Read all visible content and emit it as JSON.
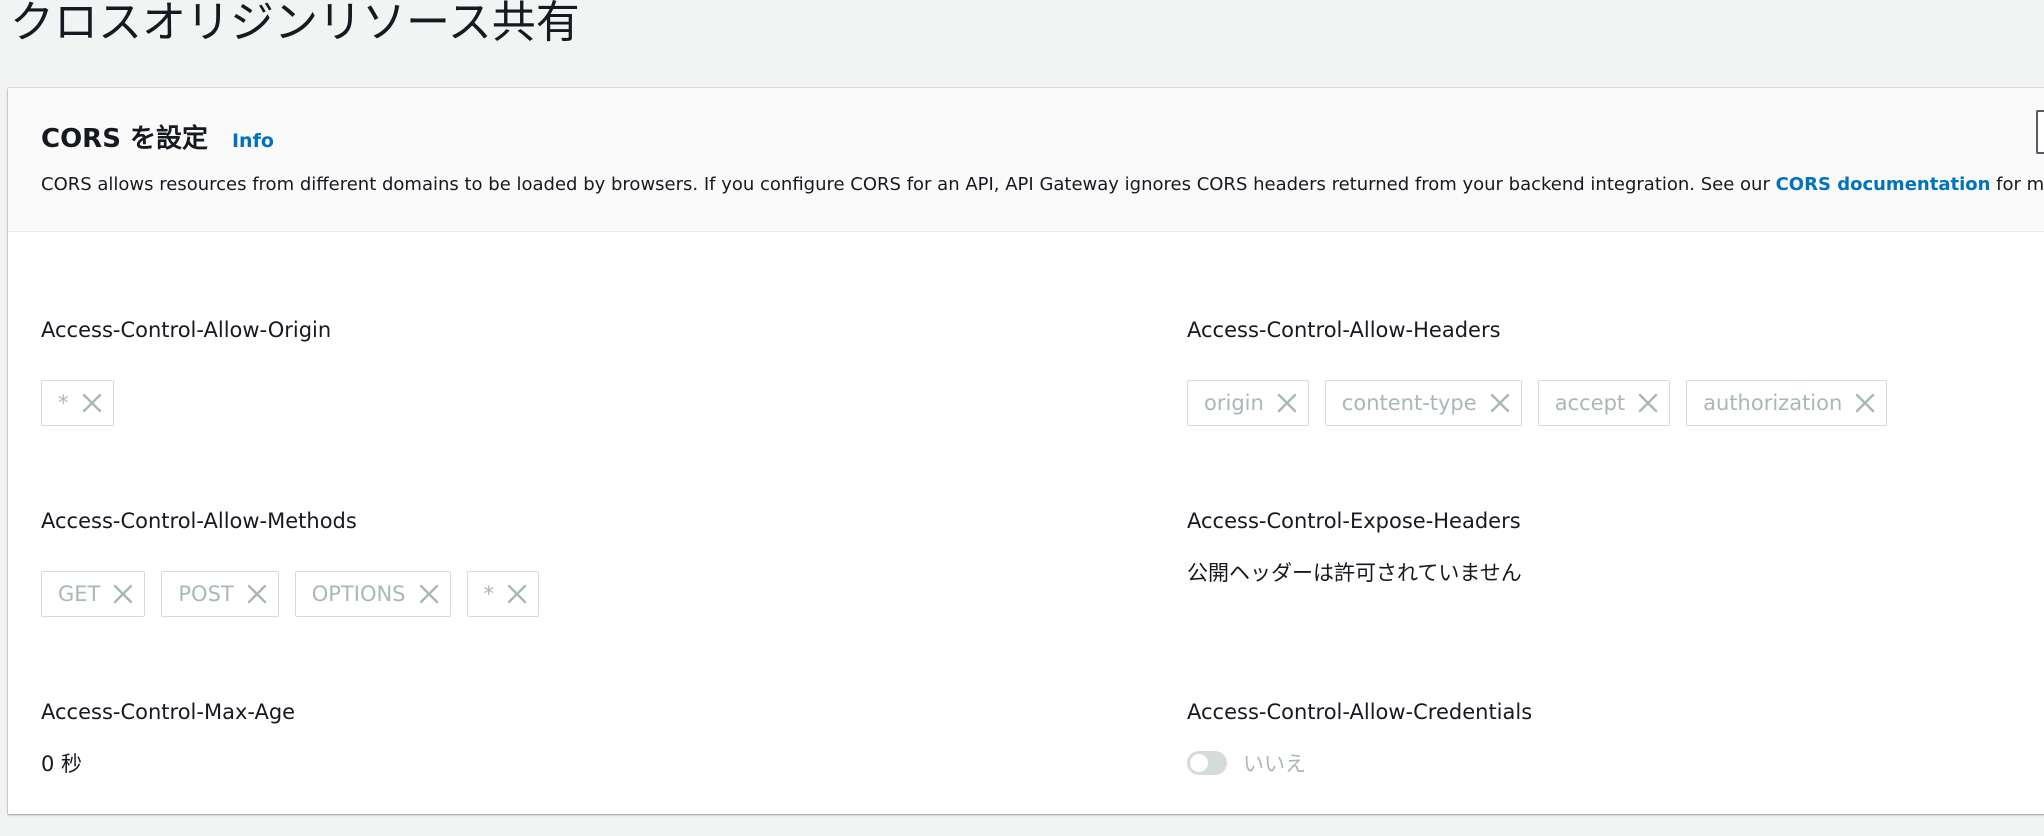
{
  "page": {
    "title": "クロスオリジンリソース共有"
  },
  "panel": {
    "title": "CORS を設定",
    "info_label": "Info",
    "description_before": "CORS allows resources from different domains to be loaded by browsers. If you configure CORS for an API, API Gateway ignores CORS headers returned from your backend integration. See our ",
    "description_link": "CORS documentation",
    "description_after": " for more details."
  },
  "fields": {
    "allow_origin": {
      "label": "Access-Control-Allow-Origin",
      "tokens": [
        "*"
      ]
    },
    "allow_headers": {
      "label": "Access-Control-Allow-Headers",
      "tokens": [
        "origin",
        "content-type",
        "accept",
        "authorization"
      ]
    },
    "allow_methods": {
      "label": "Access-Control-Allow-Methods",
      "tokens": [
        "GET",
        "POST",
        "OPTIONS",
        "*"
      ]
    },
    "expose_headers": {
      "label": "Access-Control-Expose-Headers",
      "value": "公開ヘッダーは許可されていません"
    },
    "max_age": {
      "label": "Access-Control-Max-Age",
      "value": "0 秒"
    },
    "allow_credentials": {
      "label": "Access-Control-Allow-Credentials",
      "enabled": false,
      "value_label": "いいえ"
    }
  },
  "colors": {
    "link": "#0073bb",
    "disabled_text": "#aab7b8",
    "background": "#f2f3f3"
  },
  "icons": {
    "token_remove": "close-icon"
  }
}
